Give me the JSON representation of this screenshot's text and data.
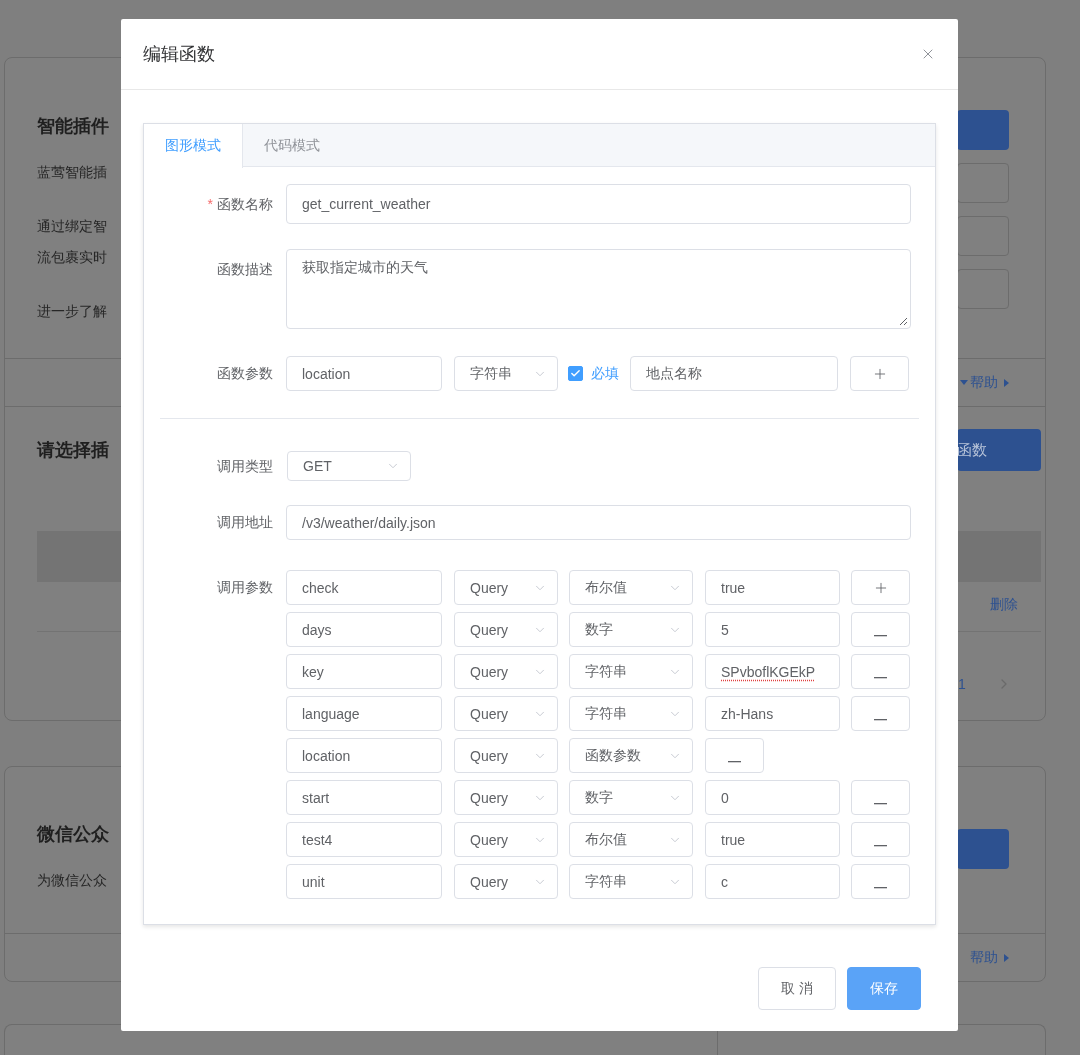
{
  "background": {
    "plugin_card": {
      "title": "智能插件",
      "lines": [
        "蓝莺智能插",
        "通过绑定智",
        "流包裹实时",
        "进一步了解"
      ],
      "help": "帮助"
    },
    "function_section": {
      "title": "请选择插",
      "add_button": "函数",
      "delete_link": "删除",
      "page": "1"
    },
    "wechat_card": {
      "title": "微信公众",
      "description": "为微信公众",
      "help": "帮助"
    }
  },
  "dialog": {
    "title": "编辑函数",
    "tabs": [
      {
        "label": "图形模式",
        "selected": true
      },
      {
        "label": "代码模式",
        "selected": false
      }
    ],
    "form": {
      "name": {
        "label": "函数名称",
        "required_mark": "*",
        "value": "get_current_weather"
      },
      "description": {
        "label": "函数描述",
        "value": "获取指定城市的天气"
      },
      "params": {
        "label": "函数参数",
        "name": "location",
        "type": "字符串",
        "required": {
          "label": "必填",
          "checked": true
        },
        "description": "地点名称"
      },
      "method": {
        "label": "调用类型",
        "value": "GET"
      },
      "url": {
        "label": "调用地址",
        "value": "/v3/weather/daily.json"
      },
      "call_params": {
        "label": "调用参数",
        "rows": [
          {
            "kind": "value",
            "name": "check",
            "in": "Query",
            "type": "布尔值",
            "value": "true",
            "misspelled": false,
            "action": {
              "kind": "add"
            }
          },
          {
            "kind": "value",
            "name": "days",
            "in": "Query",
            "type": "数字",
            "value": "5",
            "misspelled": false,
            "action": {
              "kind": "remove"
            }
          },
          {
            "kind": "value",
            "name": "key",
            "in": "Query",
            "type": "字符串",
            "value": "SPvboflKGEkP",
            "misspelled": true,
            "action": {
              "kind": "remove"
            }
          },
          {
            "kind": "value",
            "name": "language",
            "in": "Query",
            "type": "字符串",
            "value": "zh-Hans",
            "misspelled": false,
            "action": {
              "kind": "remove"
            }
          },
          {
            "kind": "param",
            "name": "location",
            "in": "Query",
            "type": "函数参数"
          },
          {
            "kind": "value",
            "name": "start",
            "in": "Query",
            "type": "数字",
            "value": "0",
            "misspelled": false,
            "action": {
              "kind": "remove"
            }
          },
          {
            "kind": "value",
            "name": "test4",
            "in": "Query",
            "type": "布尔值",
            "value": "true",
            "misspelled": false,
            "action": {
              "kind": "remove"
            }
          },
          {
            "kind": "value",
            "name": "unit",
            "in": "Query",
            "type": "字符串",
            "value": "c",
            "misspelled": false,
            "action": {
              "kind": "remove"
            }
          }
        ]
      }
    },
    "buttons": [
      {
        "label": "取 消",
        "kind": "default"
      },
      {
        "label": "保存",
        "kind": "primary"
      }
    ]
  }
}
